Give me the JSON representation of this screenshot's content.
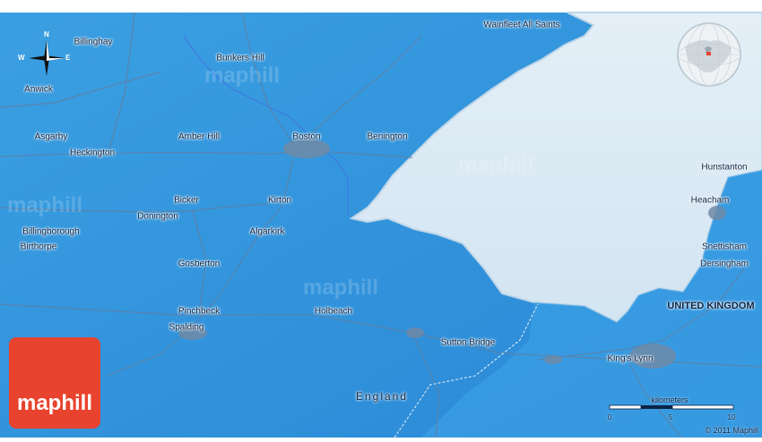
{
  "map": {
    "places": [
      {
        "name": "Wainfleet All Saints"
      },
      {
        "name": "Billinghay"
      },
      {
        "name": "Bunkers Hill"
      },
      {
        "name": "Anwick"
      },
      {
        "name": "Asgarby"
      },
      {
        "name": "Amber Hill"
      },
      {
        "name": "Boston"
      },
      {
        "name": "Benington"
      },
      {
        "name": "Heckington"
      },
      {
        "name": "Hunstanton"
      },
      {
        "name": "Bicker"
      },
      {
        "name": "Kirton"
      },
      {
        "name": "Heacham"
      },
      {
        "name": "Donington"
      },
      {
        "name": "Billingborough"
      },
      {
        "name": "Algarkirk"
      },
      {
        "name": "Birthorpe"
      },
      {
        "name": "Snettisham"
      },
      {
        "name": "Dersingham"
      },
      {
        "name": "Gosberton"
      },
      {
        "name": "Pinchbeck"
      },
      {
        "name": "Holbeach"
      },
      {
        "name": "Spalding"
      },
      {
        "name": "Sutton Bridge"
      },
      {
        "name": "King's Lynn"
      }
    ],
    "country_label": "UNITED KINGDOM",
    "region_label": "England",
    "watermark": "maphill",
    "compass": {
      "n": "N",
      "s": "S",
      "e": "E",
      "w": "W"
    },
    "colors": {
      "land": "#2f93dc",
      "sea": "#dbe9f3",
      "border_sea": "#47b3e8",
      "logo": "#e8432e"
    }
  },
  "logo": {
    "text": "maphill"
  },
  "scale": {
    "title": "kilometers",
    "ticks": [
      "0",
      "5",
      "10"
    ]
  },
  "copyright": "© 2011 Maphill"
}
